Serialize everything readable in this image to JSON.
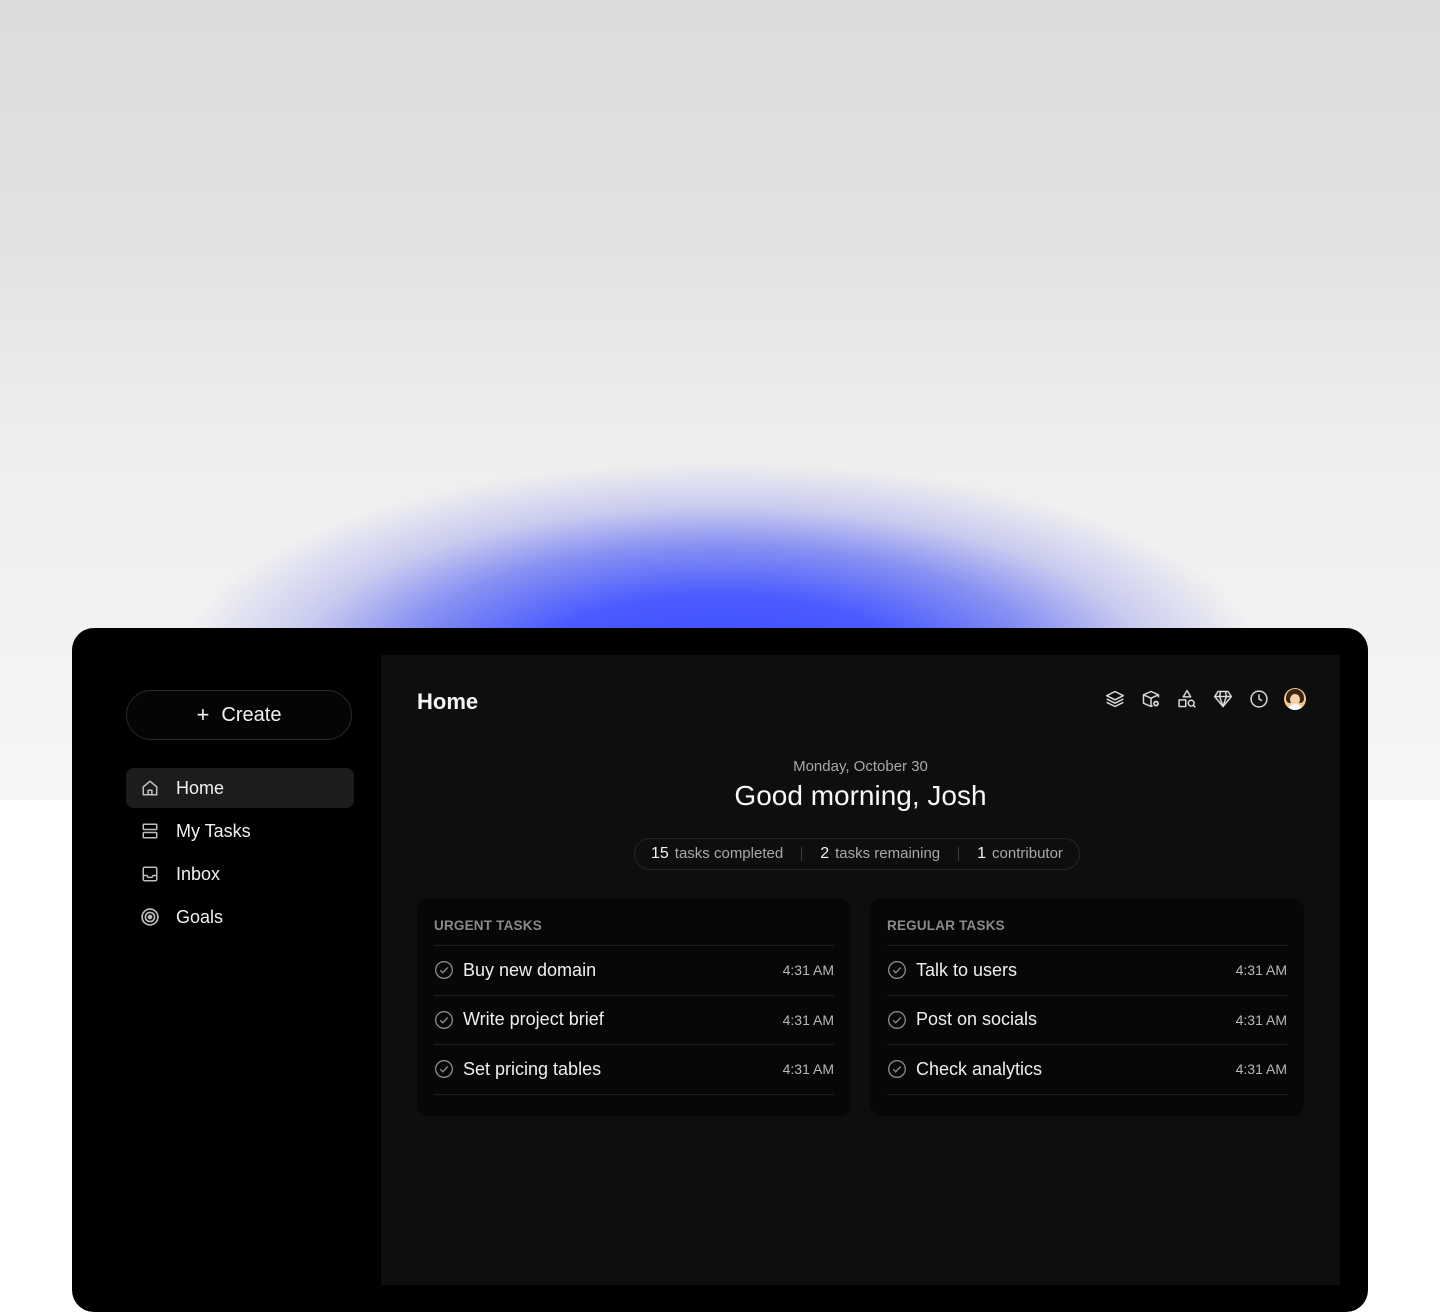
{
  "sidebar": {
    "create_label": "Create",
    "items": [
      {
        "label": "Home",
        "icon": "home-icon",
        "active": true
      },
      {
        "label": "My Tasks",
        "icon": "tasks-icon",
        "active": false
      },
      {
        "label": "Inbox",
        "icon": "inbox-icon",
        "active": false
      },
      {
        "label": "Goals",
        "icon": "target-icon",
        "active": false
      }
    ]
  },
  "header": {
    "title": "Home",
    "toolbar_icons": [
      "layers-icon",
      "box-add-icon",
      "shapes-search-icon",
      "diamond-icon",
      "clock-icon",
      "avatar"
    ]
  },
  "greeting": {
    "date": "Monday, October 30",
    "text": "Good morning, Josh"
  },
  "stats": [
    {
      "value": "15",
      "label": "tasks completed"
    },
    {
      "value": "2",
      "label": "tasks remaining"
    },
    {
      "value": "1",
      "label": "contributor"
    }
  ],
  "urgent": {
    "title": "URGENT TASKS",
    "tasks": [
      {
        "label": "Buy new domain",
        "time": "4:31 AM"
      },
      {
        "label": "Write project brief",
        "time": "4:31 AM"
      },
      {
        "label": "Set pricing tables",
        "time": "4:31 AM"
      }
    ]
  },
  "regular": {
    "title": "REGULAR TASKS",
    "tasks": [
      {
        "label": "Talk to users",
        "time": "4:31 AM"
      },
      {
        "label": "Post on socials",
        "time": "4:31 AM"
      },
      {
        "label": "Check analytics",
        "time": "4:31 AM"
      }
    ]
  },
  "colors": {
    "glow": "#3a4cff",
    "device": "#000000",
    "panel": "#0e0e0e",
    "card": "#070707"
  }
}
